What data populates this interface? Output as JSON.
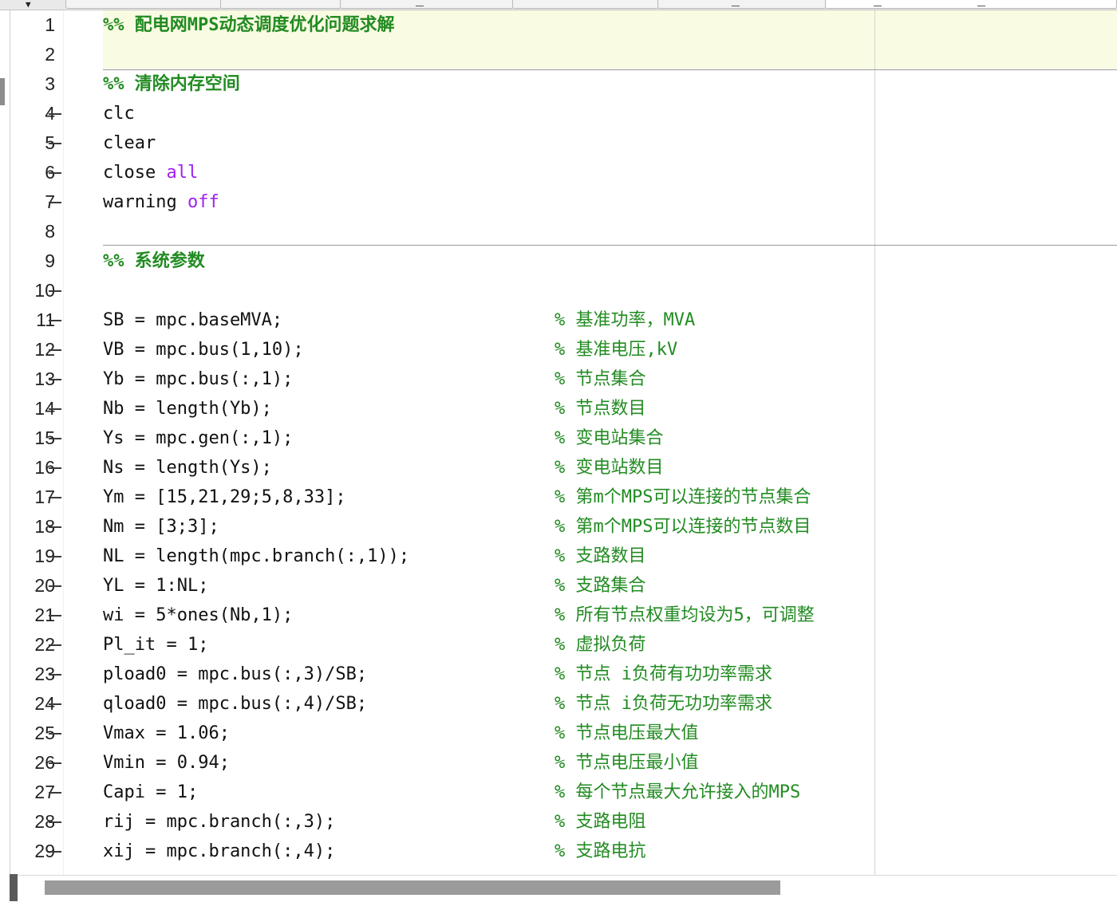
{
  "editor": {
    "lines": [
      {
        "n": "1",
        "exec": false,
        "code": [
          {
            "t": "%% 配电网MPS动态调度优化问题求解",
            "c": "sec"
          }
        ],
        "comment": ""
      },
      {
        "n": "2",
        "exec": false,
        "code": [],
        "comment": ""
      },
      {
        "n": "3",
        "exec": false,
        "code": [
          {
            "t": "%% 清除内存空间",
            "c": "sec"
          }
        ],
        "comment": ""
      },
      {
        "n": "4",
        "exec": true,
        "code": [
          {
            "t": "clc",
            "c": ""
          }
        ],
        "comment": ""
      },
      {
        "n": "5",
        "exec": true,
        "code": [
          {
            "t": "clear",
            "c": ""
          }
        ],
        "comment": ""
      },
      {
        "n": "6",
        "exec": true,
        "code": [
          {
            "t": "close ",
            "c": ""
          },
          {
            "t": "all",
            "c": "kw"
          }
        ],
        "comment": ""
      },
      {
        "n": "7",
        "exec": true,
        "code": [
          {
            "t": "warning ",
            "c": ""
          },
          {
            "t": "off",
            "c": "kw"
          }
        ],
        "comment": ""
      },
      {
        "n": "8",
        "exec": false,
        "code": [],
        "comment": ""
      },
      {
        "n": "9",
        "exec": false,
        "code": [
          {
            "t": "%% 系统参数",
            "c": "sec"
          }
        ],
        "comment": ""
      },
      {
        "n": "10",
        "exec": true,
        "code": [],
        "comment": ""
      },
      {
        "n": "11",
        "exec": true,
        "code": [
          {
            "t": "SB = mpc.baseMVA;",
            "c": ""
          }
        ],
        "comment": "% 基准功率，MVA"
      },
      {
        "n": "12",
        "exec": true,
        "code": [
          {
            "t": "VB = mpc.bus(1,10);",
            "c": ""
          }
        ],
        "comment": "% 基准电压,kV"
      },
      {
        "n": "13",
        "exec": true,
        "code": [
          {
            "t": "Yb = mpc.bus(:,1);",
            "c": ""
          }
        ],
        "comment": "% 节点集合"
      },
      {
        "n": "14",
        "exec": true,
        "code": [
          {
            "t": "Nb = length(Yb);",
            "c": ""
          }
        ],
        "comment": "% 节点数目"
      },
      {
        "n": "15",
        "exec": true,
        "code": [
          {
            "t": "Ys = mpc.gen(:,1);",
            "c": ""
          }
        ],
        "comment": "% 变电站集合"
      },
      {
        "n": "16",
        "exec": true,
        "code": [
          {
            "t": "Ns = length(Ys);",
            "c": ""
          }
        ],
        "comment": "% 变电站数目"
      },
      {
        "n": "17",
        "exec": true,
        "code": [
          {
            "t": "Ym = [15,21,29;5,8,33];",
            "c": ""
          }
        ],
        "comment": "% 第m个MPS可以连接的节点集合"
      },
      {
        "n": "18",
        "exec": true,
        "code": [
          {
            "t": "Nm = [3;3];",
            "c": ""
          }
        ],
        "comment": "% 第m个MPS可以连接的节点数目"
      },
      {
        "n": "19",
        "exec": true,
        "code": [
          {
            "t": "NL = length(mpc.branch(:,1));",
            "c": ""
          }
        ],
        "comment": "% 支路数目"
      },
      {
        "n": "20",
        "exec": true,
        "code": [
          {
            "t": "YL = 1:NL;",
            "c": ""
          }
        ],
        "comment": "% 支路集合"
      },
      {
        "n": "21",
        "exec": true,
        "code": [
          {
            "t": "wi = 5*ones(Nb,1);",
            "c": ""
          }
        ],
        "comment": "% 所有节点权重均设为5，可调整"
      },
      {
        "n": "22",
        "exec": true,
        "code": [
          {
            "t": "Pl_it = 1;",
            "c": ""
          }
        ],
        "comment": "% 虚拟负荷"
      },
      {
        "n": "23",
        "exec": true,
        "code": [
          {
            "t": "pload0 = mpc.bus(:,3)/SB;",
            "c": ""
          }
        ],
        "comment": "% 节点 i负荷有功功率需求"
      },
      {
        "n": "24",
        "exec": true,
        "code": [
          {
            "t": "qload0 = mpc.bus(:,4)/SB;",
            "c": ""
          }
        ],
        "comment": "% 节点 i负荷无功功率需求"
      },
      {
        "n": "25",
        "exec": true,
        "code": [
          {
            "t": "Vmax = 1.06;",
            "c": ""
          }
        ],
        "comment": "% 节点电压最大值"
      },
      {
        "n": "26",
        "exec": true,
        "code": [
          {
            "t": "Vmin = 0.94;",
            "c": ""
          }
        ],
        "comment": "% 节点电压最小值"
      },
      {
        "n": "27",
        "exec": true,
        "code": [
          {
            "t": "Capi = 1;",
            "c": ""
          }
        ],
        "comment": "% 每个节点最大允许接入的MPS"
      },
      {
        "n": "28",
        "exec": true,
        "code": [
          {
            "t": "rij = mpc.branch(:,3);",
            "c": ""
          }
        ],
        "comment": "% 支路电阻"
      },
      {
        "n": "29",
        "exec": true,
        "code": [
          {
            "t": "xij = mpc.branch(:,4);",
            "c": ""
          }
        ],
        "comment": "% 支路电抗"
      }
    ]
  }
}
